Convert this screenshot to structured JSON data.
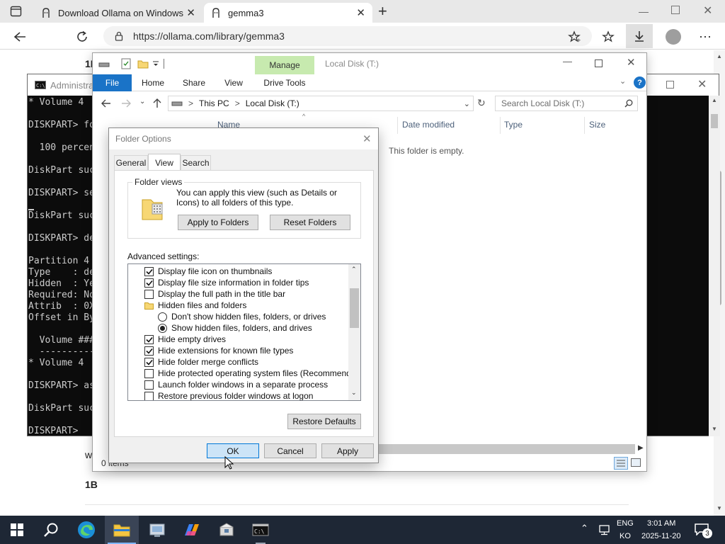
{
  "browser": {
    "tabs": [
      {
        "title": "Download Ollama on Windows"
      },
      {
        "title": "gemma3"
      }
    ],
    "new_tab_label": "+",
    "url": "https://ollama.com/library/gemma3"
  },
  "webpage": {
    "fragments": [
      "1B",
      "w",
      "1B"
    ]
  },
  "cmd": {
    "title": "Administrat",
    "lines": [
      "* Volume 4",
      "",
      "DISKPART> fo",
      "",
      "  100 percen",
      "",
      "DiskPart suc",
      "",
      "DISKPART> se",
      "",
      "DiskPart suc",
      "",
      "DISKPART> de",
      "",
      "Partition 4",
      "Type    : de",
      "Hidden  : Ye",
      "Required: No",
      "Attrib  : 0X",
      "Offset in By",
      "",
      "  Volume ###",
      "  ----------",
      "* Volume 4",
      "",
      "DISKPART> as",
      "",
      "DiskPart suc",
      "",
      "DISKPART> "
    ]
  },
  "explorer": {
    "title": "Local Disk (T:)",
    "manage_label": "Manage",
    "ribbon_tabs": [
      "File",
      "Home",
      "Share",
      "View",
      "Drive Tools"
    ],
    "breadcrumb": [
      "This PC",
      "Local Disk (T:)"
    ],
    "breadcrumb_sep": ">",
    "search_placeholder": "Search Local Disk (T:)",
    "columns": [
      "Name",
      "Date modified",
      "Type",
      "Size"
    ],
    "empty_message": "This folder is empty.",
    "status": "0 items"
  },
  "dialog": {
    "title": "Folder Options",
    "tabs": [
      "General",
      "View",
      "Search"
    ],
    "selected_tab": "View",
    "folder_views": {
      "legend": "Folder views",
      "description": "You can apply this view (such as Details or Icons) to all folders of this type.",
      "apply_button": "Apply to Folders",
      "reset_button": "Reset Folders"
    },
    "advanced_label": "Advanced settings:",
    "settings": [
      {
        "kind": "checkbox",
        "label": "Display file icon on thumbnails",
        "checked": true
      },
      {
        "kind": "checkbox",
        "label": "Display file size information in folder tips",
        "checked": true
      },
      {
        "kind": "checkbox",
        "label": "Display the full path in the title bar",
        "checked": false
      },
      {
        "kind": "folder",
        "label": "Hidden files and folders"
      },
      {
        "kind": "radio",
        "label": "Don't show hidden files, folders, or drives",
        "checked": false
      },
      {
        "kind": "radio",
        "label": "Show hidden files, folders, and drives",
        "checked": true
      },
      {
        "kind": "checkbox",
        "label": "Hide empty drives",
        "checked": true
      },
      {
        "kind": "checkbox",
        "label": "Hide extensions for known file types",
        "checked": true
      },
      {
        "kind": "checkbox",
        "label": "Hide folder merge conflicts",
        "checked": true
      },
      {
        "kind": "checkbox",
        "label": "Hide protected operating system files (Recommended)",
        "checked": false
      },
      {
        "kind": "checkbox",
        "label": "Launch folder windows in a separate process",
        "checked": false
      },
      {
        "kind": "checkbox",
        "label": "Restore previous folder windows at logon",
        "checked": false
      }
    ],
    "restore_defaults": "Restore Defaults",
    "ok": "OK",
    "cancel": "Cancel",
    "apply": "Apply"
  },
  "taskbar": {
    "lang_top": "ENG",
    "lang_bottom": "KO",
    "time": "3:01 AM",
    "date": "2025-11-20",
    "notification_count": "3",
    "apps": [
      "windows-start",
      "search",
      "edge",
      "file-explorer",
      "control-panel",
      "copilot",
      "installer",
      "terminal"
    ]
  },
  "colors": {
    "file_tab": "#1a73c7",
    "manage_tab": "#c7eaaf",
    "taskbar": "#1e2735",
    "ok_button": "#cce4f7",
    "ok_border": "#0078d7"
  }
}
